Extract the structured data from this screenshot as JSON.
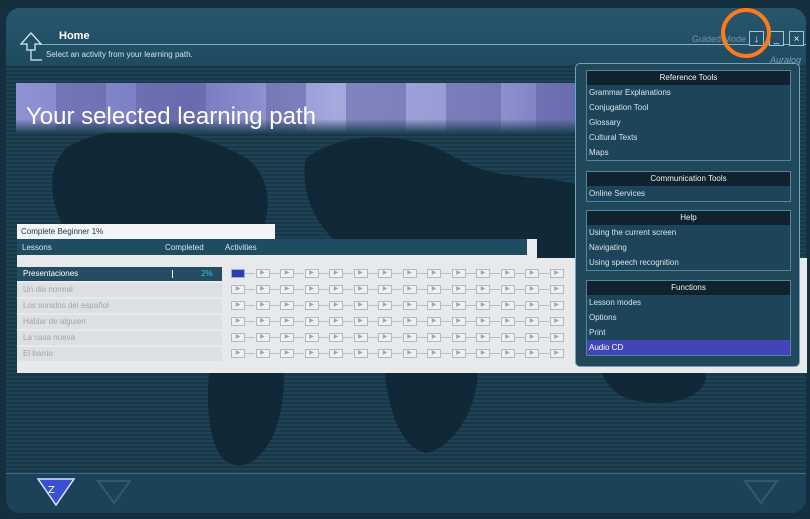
{
  "header": {
    "title": "Home",
    "subtitle": "Select an activity from your learning path.",
    "guided_mode_label": "Guided Mode |",
    "brand": "Auralog",
    "buttons": {
      "help": "↓",
      "minimize": "_",
      "close": "×"
    }
  },
  "banner": {
    "title": "Your selected learning path"
  },
  "path": {
    "tab_label": "Complete Beginner 1%",
    "columns": {
      "lessons": "Lessons",
      "completed": "Completed",
      "activities": "Activities"
    },
    "lessons": [
      {
        "name": "Presentaciones",
        "completed": "2%",
        "selected": true
      },
      {
        "name": "Un dia normal",
        "completed": "",
        "selected": false
      },
      {
        "name": "Los sonidos del español",
        "completed": "",
        "selected": false
      },
      {
        "name": "Hablar de alguien",
        "completed": "",
        "selected": false
      },
      {
        "name": "La casa nueva",
        "completed": "",
        "selected": false
      },
      {
        "name": "El barrio",
        "completed": "",
        "selected": false
      }
    ]
  },
  "tools": {
    "reference": {
      "title": "Reference Tools",
      "items": [
        "Grammar Explanations",
        "Conjugation Tool",
        "Glossary",
        "Cultural Texts",
        "Maps"
      ]
    },
    "communication": {
      "title": "Communication Tools",
      "items": [
        "Online Services"
      ]
    },
    "help": {
      "title": "Help",
      "items": [
        "Using the current screen",
        "Navigating",
        "Using speech recognition"
      ]
    },
    "functions": {
      "title": "Functions",
      "items": [
        "Lesson modes",
        "Options",
        "Print",
        "Audio CD"
      ],
      "active_index": 3
    }
  },
  "colors": {
    "accent": "#4145b8",
    "highlight_circle": "#ff7a1a",
    "progress": "#3bc2d6"
  },
  "icons": [
    "home-arrow-icon",
    "help-arrow-icon",
    "minimize-icon",
    "close-icon",
    "zoom-nav-icon",
    "back-nav-icon",
    "forward-nav-icon"
  ]
}
